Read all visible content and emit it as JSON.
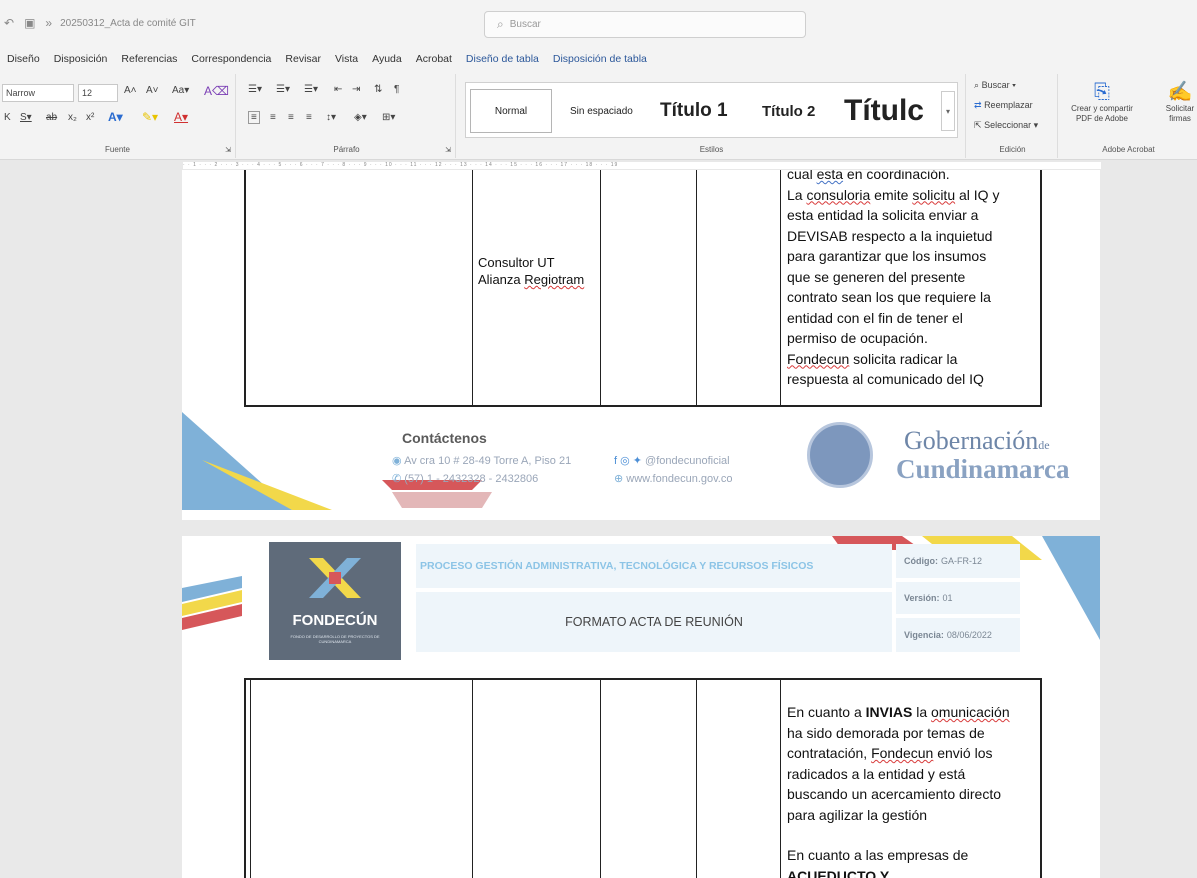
{
  "titlebar": {
    "doc_title": "20250312_Acta de comité GIT",
    "search_placeholder": "Buscar"
  },
  "menu": {
    "tabs": [
      "Diseño",
      "Disposición",
      "Referencias",
      "Correspondencia",
      "Revisar",
      "Vista",
      "Ayuda",
      "Acrobat"
    ],
    "context_tabs": [
      "Diseño de tabla",
      "Disposición de tabla"
    ]
  },
  "ribbon": {
    "font_name": "Narrow",
    "font_size": "12",
    "group_fuente": "Fuente",
    "group_parrafo": "Párrafo",
    "group_estilos": "Estilos",
    "group_edicion": "Edición",
    "group_acrobat": "Adobe Acrobat",
    "styles": {
      "normal": "Normal",
      "sin_espaciado": "Sin espaciado",
      "titulo1": "Título 1",
      "titulo2": "Título 2",
      "titulo": "Títulc"
    },
    "edicion": {
      "buscar": "Buscar",
      "reemplazar": "Reemplazar",
      "seleccionar": "Seleccionar"
    },
    "acrobat": {
      "crear_line1": "Crear y compartir",
      "crear_line2": "PDF de Adobe",
      "solicitar_line1": "Solicitar",
      "solicitar_line2": "firmas"
    }
  },
  "page1": {
    "consultor_line1": "Consultor UT",
    "consultor_line2_a": "Alianza ",
    "consultor_line2_b": "Regiotram",
    "notes": {
      "l1a": "cual ",
      "l1b": "esta",
      "l1c": " en coordinación.",
      "l2a": "La ",
      "l2b": "consuloria",
      "l2c": " emite ",
      "l2d": "solicitu",
      "l2e": " al IQ y",
      "l3": "esta entidad la solicita enviar a",
      "l4": "DEVISAB respecto a la inquietud",
      "l5": "para garantizar que los insumos",
      "l6": "que se generen del presente",
      "l7": "contrato sean los que requiere la",
      "l8": "entidad con el fin de tener el",
      "l9": "permiso de ocupación.",
      "l10a": "Fondecun",
      "l10b": " solicita radicar la",
      "l11": "respuesta al comunicado del IQ"
    },
    "footer": {
      "contact_title": "Contáctenos",
      "address": "Av cra 10 # 28-49 Torre A, Piso 21",
      "phone": "(57) 1 - 2432328 - 2432806",
      "social": "@fondecunoficial",
      "web": "www.fondecun.gov.co",
      "gob": "Gobernación",
      "gob_de": "de",
      "cund": "Cundinamarca"
    }
  },
  "page2": {
    "logo_name": "FONDECÚN",
    "logo_sub": "FONDO DE DESARROLLO DE PROYECTOS DE CUNDINAMARCA",
    "proceso": "PROCESO GESTIÓN ADMINISTRATIVA, TECNOLÓGICA Y RECURSOS FÍSICOS",
    "formato": "FORMATO ACTA DE REUNIÓN",
    "codigo_label": "Código:",
    "codigo": "GA-FR-12",
    "version_label": "Versión:",
    "version": "01",
    "vigencia_label": "Vigencia:",
    "vigencia": "08/06/2022",
    "notes": {
      "l1a": "En cuanto a ",
      "l1b": "INVIAS",
      "l1c": " la ",
      "l1d": "omunicación",
      "l2": "ha sido demorada por temas de",
      "l3a": "contratación, ",
      "l3b": "Fondecun",
      "l3c": " envió los",
      "l4": "radicados a la entidad y está",
      "l5": "buscando un acercamiento directo",
      "l6": "para agilizar la gestión",
      "l7": "En cuanto a las empresas de",
      "l8": "ACUEDUCTO Y"
    }
  }
}
